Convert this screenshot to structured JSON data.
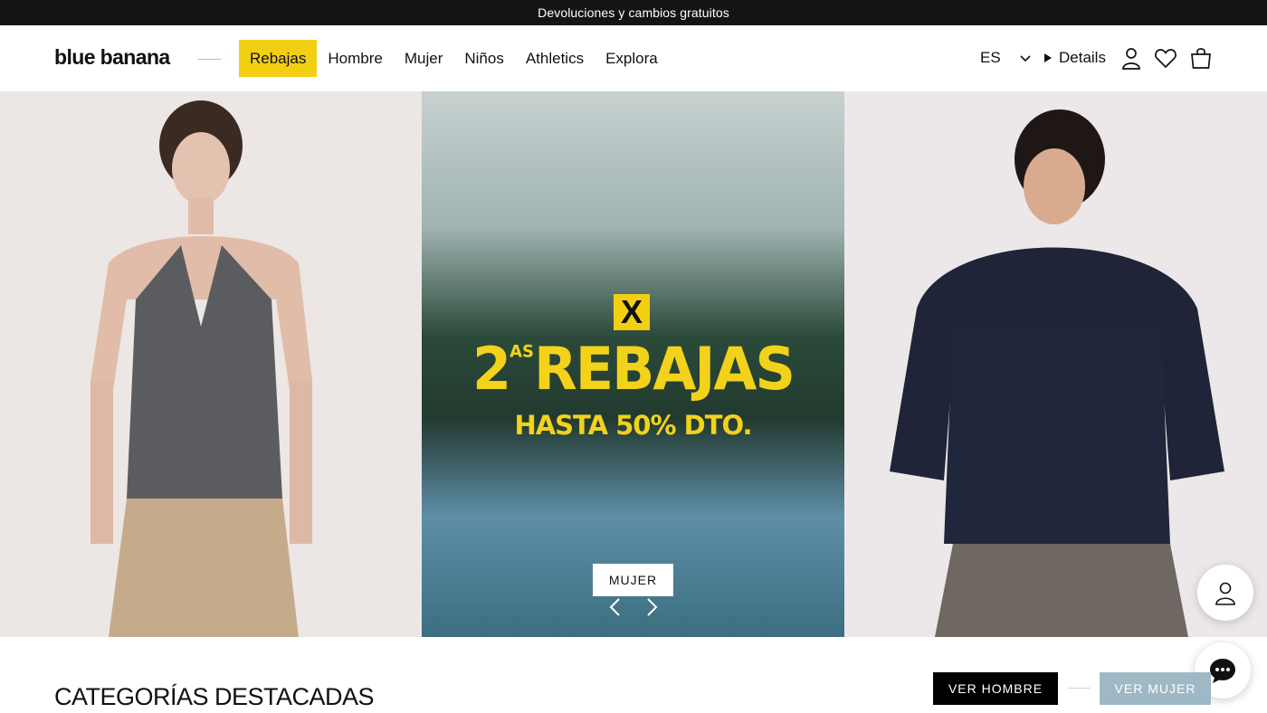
{
  "announcement": "Devoluciones y cambios gratuitos",
  "header": {
    "logo": "blue banana",
    "nav": [
      "Rebajas",
      "Hombre",
      "Mujer",
      "Niños",
      "Athletics",
      "Explora"
    ],
    "active_nav": "Rebajas",
    "language": "ES",
    "details_label": "Details",
    "icons": [
      "chevron-down-icon",
      "play-triangle-icon",
      "user-icon",
      "heart-icon",
      "shopping-bag-icon"
    ]
  },
  "hero": {
    "promo_badge": "X",
    "promo_title": "2",
    "promo_title_sup": "AS",
    "promo_title_word": "REBAJAS",
    "promo_subtitle": "HASTA 50% DTO.",
    "cta_label": "MUJER",
    "icons": [
      "chevron-left-icon",
      "chevron-right-icon"
    ]
  },
  "featured": {
    "title": "CATEGORÍAS DESTACADAS",
    "buttons": [
      "VER HOMBRE",
      "VER MUJER"
    ]
  },
  "floating": {
    "icons": [
      "account-icon",
      "chat-icon"
    ]
  },
  "colors": {
    "accent_yellow": "#f3cf14",
    "top_bar": "#141414",
    "ver_mujer_bg": "#9fb8c6"
  }
}
